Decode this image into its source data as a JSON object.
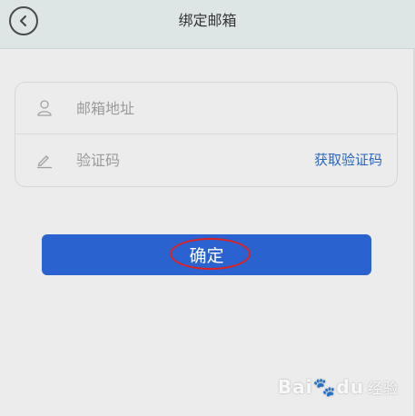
{
  "header": {
    "title": "绑定邮箱"
  },
  "form": {
    "email_placeholder": "邮箱地址",
    "code_placeholder": "验证码",
    "get_code_label": "获取验证码"
  },
  "actions": {
    "confirm_label": "确定"
  },
  "watermark": {
    "brand": "Bai",
    "brand2": "du",
    "sub": "经验"
  },
  "colors": {
    "accent": "#2a62cf",
    "link": "#2a66c4",
    "header_bg": "#dde5e5",
    "annotation": "#e02020"
  },
  "icons": {
    "back": "chevron-left-icon",
    "email": "user-icon",
    "code": "pencil-icon"
  }
}
